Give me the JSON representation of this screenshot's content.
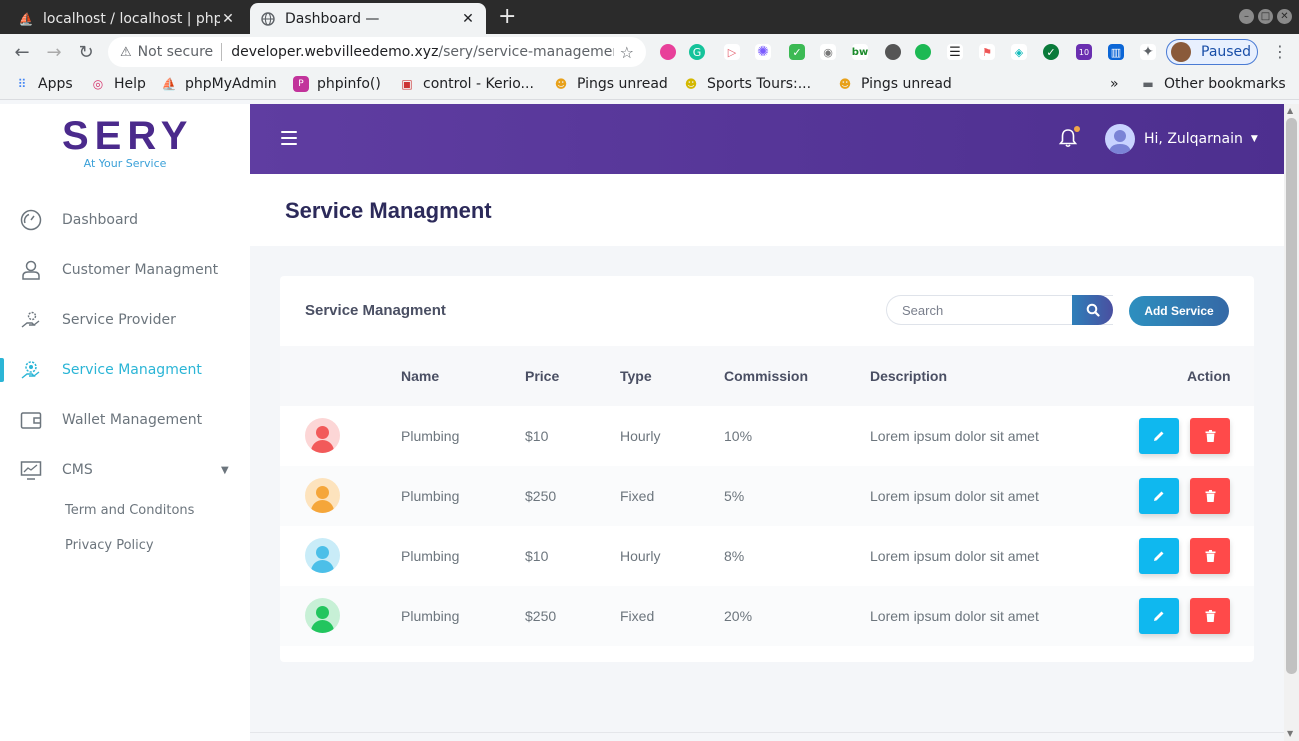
{
  "browser": {
    "tabs": [
      {
        "title": "localhost / localhost | php",
        "active": false
      },
      {
        "title": "Dashboard —",
        "active": true
      }
    ],
    "address": {
      "security": "Not secure",
      "url_host": "developer.webvilleedemo.xyz",
      "url_path": "/sery/service-management...."
    },
    "profile_label": "Paused",
    "extension_badge": "10",
    "bookmarks": [
      {
        "label": "Apps",
        "icon": "apps-grid-icon"
      },
      {
        "label": "Help",
        "icon": "help-icon"
      },
      {
        "label": "phpMyAdmin",
        "icon": "phpmyadmin-icon"
      },
      {
        "label": "phpinfo()",
        "icon": "php-icon"
      },
      {
        "label": "control - Kerio...",
        "icon": "kerio-icon"
      },
      {
        "label": "Pings unread",
        "icon": "pings-icon"
      },
      {
        "label": "Sports Tours:...",
        "icon": "sports-icon"
      },
      {
        "label": "Pings unread",
        "icon": "pings-icon"
      }
    ],
    "bookmarks_overflow": "»",
    "other_bookmarks": "Other bookmarks"
  },
  "app": {
    "logo": {
      "brand": "SERY",
      "tagline": "At Your Service"
    },
    "sidebar": {
      "items": [
        {
          "label": "Dashboard",
          "icon": "dashboard-gauge-icon"
        },
        {
          "label": "Customer Managment",
          "icon": "user-icon"
        },
        {
          "label": "Service Provider",
          "icon": "hand-gear-icon"
        },
        {
          "label": "Service Managment",
          "icon": "gear-user-icon",
          "active": true
        },
        {
          "label": "Wallet Management",
          "icon": "wallet-icon"
        },
        {
          "label": "CMS",
          "icon": "monitor-chart-icon"
        }
      ],
      "cms_sub": [
        "Term and Conditons",
        "Privacy Policy"
      ]
    },
    "topbar": {
      "greeting": "Hi, Zulqarnain"
    },
    "page_title": "Service Managment",
    "card": {
      "title": "Service Managment",
      "search_placeholder": "Search",
      "add_button": "Add Service",
      "columns": [
        "Name",
        "Price",
        "Type",
        "Commission",
        "Description",
        "Action"
      ],
      "rows": [
        {
          "name": "Plumbing",
          "price": "$10",
          "type": "Hourly",
          "commission": "10%",
          "description": "Lorem ipsum dolor sit amet",
          "avatar_color": "#f25a5a",
          "avatar_bg": "#fcd6d6"
        },
        {
          "name": "Plumbing",
          "price": "$250",
          "type": "Fixed",
          "commission": "5%",
          "description": "Lorem ipsum dolor sit amet",
          "avatar_color": "#f5a63a",
          "avatar_bg": "#fde3bd"
        },
        {
          "name": "Plumbing",
          "price": "$10",
          "type": "Hourly",
          "commission": "8%",
          "description": "Lorem ipsum dolor sit amet",
          "avatar_color": "#4cbfe8",
          "avatar_bg": "#c9ecf8"
        },
        {
          "name": "Plumbing",
          "price": "$250",
          "type": "Fixed",
          "commission": "20%",
          "description": "Lorem ipsum dolor sit amet",
          "avatar_color": "#22c55e",
          "avatar_bg": "#c7f0d6"
        }
      ]
    },
    "colors": {
      "accent": "#2bb5d6",
      "brand_purple": "#4b2a8c",
      "edit": "#0fb8ef",
      "delete": "#ff4a4a"
    }
  }
}
